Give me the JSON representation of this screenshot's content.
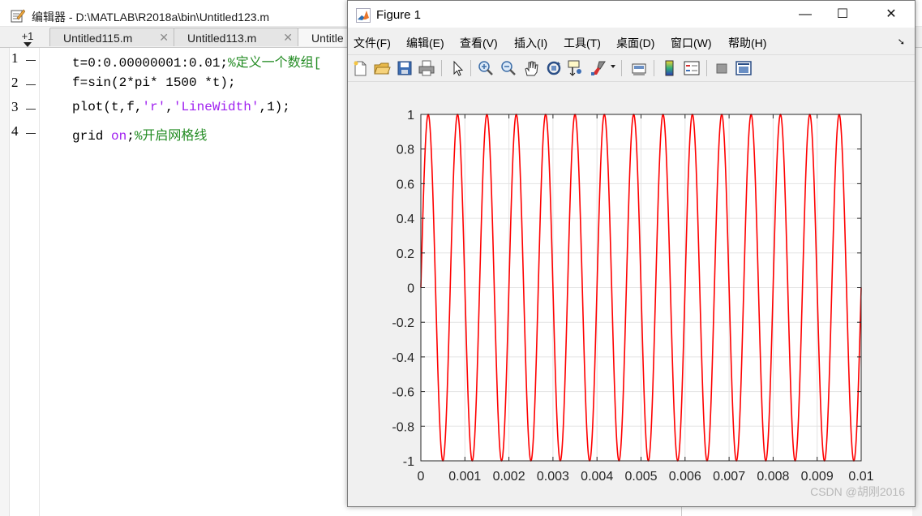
{
  "editor": {
    "title": "编辑器 - D:\\MATLAB\\R2018a\\bin\\Untitled123.m",
    "plus_label": "+1",
    "tabs": [
      {
        "label": "Untitled115.m"
      },
      {
        "label": "Untitled113.m"
      },
      {
        "label": "Untitle"
      }
    ],
    "lines": [
      {
        "num": "1",
        "parts": [
          "t=0:0.00000001:0.01;",
          "%定义一个数组[",
          ""
        ]
      },
      {
        "num": "2",
        "parts": [
          "f=sin(2*pi* 1500 *t);",
          "",
          ""
        ]
      },
      {
        "num": "3",
        "parts": [
          "plot(t,f,",
          "'r'",
          ",",
          "'LineWidth'",
          ",1);"
        ]
      },
      {
        "num": "4",
        "parts": [
          "grid ",
          "on",
          ";",
          "%开启网格线"
        ]
      }
    ]
  },
  "figure": {
    "title": "Figure 1",
    "menus": [
      "文件(F)",
      "编辑(E)",
      "查看(V)",
      "插入(I)",
      "工具(T)",
      "桌面(D)",
      "窗口(W)",
      "帮助(H)"
    ],
    "toolbar_icons": [
      "new-figure-icon",
      "open-file-icon",
      "save-icon",
      "print-icon",
      "pointer-icon",
      "zoom-in-icon",
      "zoom-out-icon",
      "pan-icon",
      "rotate-3d-icon",
      "data-cursor-icon",
      "brush-icon",
      "link-plot-icon",
      "colorbar-icon",
      "legend-icon",
      "hide-plot-tools-icon",
      "show-plot-tools-icon"
    ],
    "window_buttons": {
      "minimize": "—",
      "maximize": "☐",
      "close": "✕"
    }
  },
  "chart_data": {
    "type": "line",
    "title": "",
    "xlabel": "",
    "ylabel": "",
    "xlim": [
      0,
      0.01
    ],
    "ylim": [
      -1,
      1
    ],
    "xticks": [
      "0",
      "0.001",
      "0.002",
      "0.003",
      "0.004",
      "0.005",
      "0.006",
      "0.007",
      "0.008",
      "0.009",
      "0.01"
    ],
    "yticks": [
      "1",
      "0.8",
      "0.6",
      "0.4",
      "0.2",
      "0",
      "-0.2",
      "-0.4",
      "-0.6",
      "-0.8",
      "-1"
    ],
    "grid": true,
    "series": [
      {
        "function": "sin(2*pi*1500*t)",
        "frequency_hz": 1500,
        "amplitude": 1,
        "color": "#ff0000"
      }
    ]
  },
  "watermark": "CSDN @胡刚2016"
}
